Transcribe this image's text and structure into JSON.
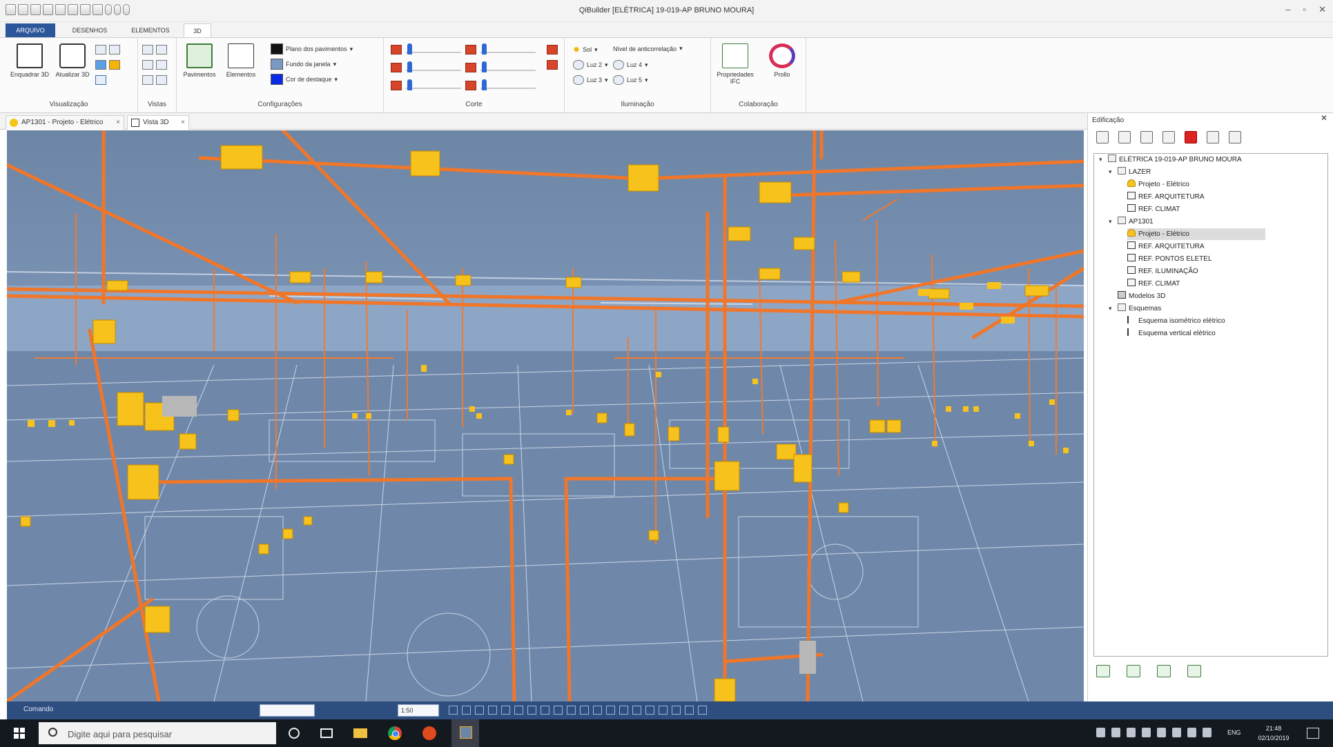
{
  "window": {
    "title": "QiBuilder [ELÉTRICA] 19-019-AP BRUNO MOURA]",
    "controls": [
      "–",
      "▫",
      "✕"
    ]
  },
  "ribbon_tabs": [
    {
      "label": "ARQUIVO"
    },
    {
      "label": "DESENHOS"
    },
    {
      "label": "ELEMENTOS"
    },
    {
      "label": "3D"
    }
  ],
  "ribbon": {
    "visualizacao": {
      "label": "Visualização",
      "enquadrar": "Enquadrar 3D",
      "atualizar": "Atualizar 3D"
    },
    "vistas": {
      "label": "Vistas"
    },
    "configuracoes": {
      "label": "Configurações",
      "pavimentos": "Pavimentos",
      "elementos": "Elementos",
      "fundo_pav": "Plano dos pavimentos",
      "fundo_janela": "Fundo da janela",
      "cor_destaque": "Cor de destaque"
    },
    "corte": {
      "label": "Corte"
    },
    "iluminacao": {
      "label": "Iluminação",
      "sol": "Sol",
      "nivel": "Nível de anticorrelação",
      "luz2": "Luz 2",
      "luz3": "Luz 3",
      "luz4": "Luz 4",
      "luz5": "Luz 5"
    },
    "colaboracao": {
      "label": "Colaboração",
      "propriedades": "Propriedades IFC",
      "prollo": "Prollo"
    }
  },
  "doc_tabs": [
    {
      "label": "AP1301 - Projeto - Elétrico"
    },
    {
      "label": "Vista 3D"
    }
  ],
  "side_panel": {
    "title": "Edificação",
    "close": "✕",
    "tree": [
      {
        "label": "ELÉTRICA 19-019-AP BRUNO MOURA",
        "icon": "building-icon",
        "level": 0,
        "exp": "▾"
      },
      {
        "label": "LAZER",
        "icon": "floor-icon",
        "level": 1,
        "exp": "▾"
      },
      {
        "label": "Projeto - Elétrico",
        "icon": "bulb-icon",
        "level": 2,
        "exp": ""
      },
      {
        "label": "REF. ARQUITETURA",
        "icon": "ref-icon",
        "level": 2,
        "exp": ""
      },
      {
        "label": "REF. CLIMAT",
        "icon": "ref-icon",
        "level": 2,
        "exp": ""
      },
      {
        "label": "AP1301",
        "icon": "floor-icon",
        "level": 1,
        "exp": "▾"
      },
      {
        "label": "Projeto - Elétrico",
        "icon": "bulb-icon",
        "level": 2,
        "exp": "",
        "selected": true
      },
      {
        "label": "REF. ARQUITETURA",
        "icon": "ref-icon",
        "level": 2,
        "exp": ""
      },
      {
        "label": "REF. PONTOS ELETEL",
        "icon": "ref-icon",
        "level": 2,
        "exp": ""
      },
      {
        "label": "REF. ILUMINAÇÃO",
        "icon": "ref-icon",
        "level": 2,
        "exp": ""
      },
      {
        "label": "REF. CLIMAT",
        "icon": "ref-icon",
        "level": 2,
        "exp": ""
      },
      {
        "label": "Modelos 3D",
        "icon": "cube-icon",
        "level": 1,
        "exp": ""
      },
      {
        "label": "Esquemas",
        "icon": "diagram-icon",
        "level": 1,
        "exp": "▾"
      },
      {
        "label": "Esquema isométrico elétrico",
        "icon": "schema-icon",
        "level": 2,
        "exp": ""
      },
      {
        "label": "Esquema vertical elétrico",
        "icon": "schema-icon",
        "level": 2,
        "exp": ""
      }
    ]
  },
  "command_bar": {
    "label": "Comando",
    "combo": "1:50"
  },
  "taskbar": {
    "search_placeholder": "Digite aqui para pesquisar",
    "lang": "ENG",
    "time": "21:48",
    "date": "02/10/2019"
  }
}
